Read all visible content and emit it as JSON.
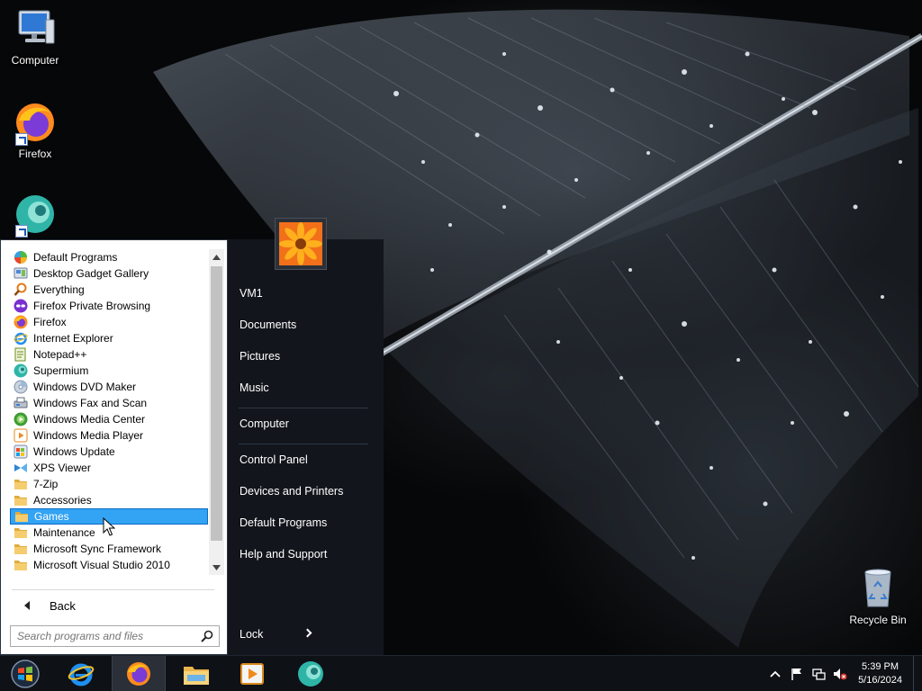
{
  "desktop": {
    "icons": [
      {
        "label": "Computer",
        "icon": "computer-icon"
      },
      {
        "label": "Firefox",
        "icon": "firefox-icon"
      },
      {
        "label": "",
        "icon": "supermium-icon"
      },
      {
        "label": "Recycle Bin",
        "icon": "recycle-bin-icon"
      }
    ]
  },
  "start_menu": {
    "programs": [
      {
        "label": "Default Programs",
        "icon": "default-programs-icon"
      },
      {
        "label": "Desktop Gadget Gallery",
        "icon": "gadget-gallery-icon"
      },
      {
        "label": "Everything",
        "icon": "everything-search-icon"
      },
      {
        "label": "Firefox Private Browsing",
        "icon": "firefox-private-icon"
      },
      {
        "label": "Firefox",
        "icon": "firefox-icon"
      },
      {
        "label": "Internet Explorer",
        "icon": "internet-explorer-icon"
      },
      {
        "label": "Notepad++",
        "icon": "notepadpp-icon"
      },
      {
        "label": "Supermium",
        "icon": "supermium-icon"
      },
      {
        "label": "Windows DVD Maker",
        "icon": "dvd-maker-icon"
      },
      {
        "label": "Windows Fax and Scan",
        "icon": "fax-scan-icon"
      },
      {
        "label": "Windows Media Center",
        "icon": "media-center-icon"
      },
      {
        "label": "Windows Media Player",
        "icon": "media-player-icon"
      },
      {
        "label": "Windows Update",
        "icon": "windows-update-icon"
      },
      {
        "label": "XPS Viewer",
        "icon": "xps-viewer-icon"
      },
      {
        "label": "7-Zip",
        "icon": "folder-icon"
      },
      {
        "label": "Accessories",
        "icon": "folder-icon"
      },
      {
        "label": "Games",
        "icon": "folder-icon",
        "selected": true
      },
      {
        "label": "Maintenance",
        "icon": "folder-icon"
      },
      {
        "label": "Microsoft Sync Framework",
        "icon": "folder-icon"
      },
      {
        "label": "Microsoft Visual Studio 2010",
        "icon": "folder-icon"
      }
    ],
    "back_label": "Back",
    "search_placeholder": "Search programs and files",
    "right_pane": {
      "user": "VM1",
      "items": [
        "Documents",
        "Pictures",
        "Music",
        "Computer",
        "Control Panel",
        "Devices and Printers",
        "Default Programs",
        "Help and Support"
      ],
      "lock_label": "Lock"
    }
  },
  "taskbar": {
    "pinned": [
      "start-orb-icon",
      "internet-explorer-icon",
      "firefox-icon",
      "file-explorer-icon",
      "media-player-icon",
      "supermium-icon"
    ],
    "clock_time": "5:39 PM",
    "clock_date": "5/16/2024"
  },
  "colors": {
    "selection": "#33a3f4",
    "right_pane_bg": "#12161c",
    "taskbar_bg": "#0e1116"
  }
}
